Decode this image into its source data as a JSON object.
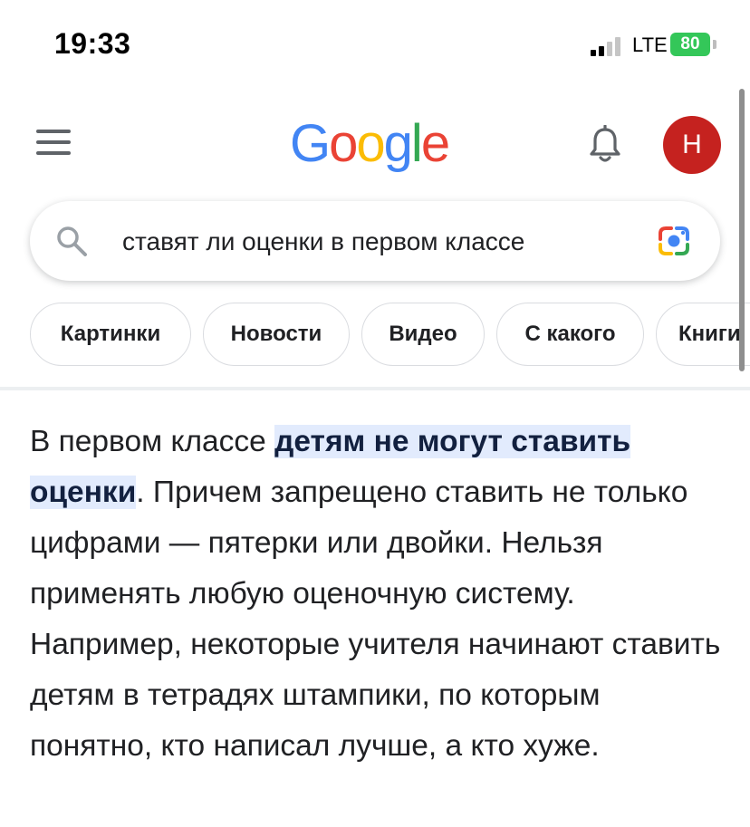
{
  "status_bar": {
    "time": "19:33",
    "network": "LTE",
    "battery": "80"
  },
  "header": {
    "logo_letters": [
      "G",
      "o",
      "o",
      "g",
      "l",
      "e"
    ],
    "avatar_letter": "H",
    "icons": {
      "menu": "hamburger-menu-icon",
      "notifications": "bell-icon"
    }
  },
  "search": {
    "query": "ставят ли оценки в первом классе",
    "icons": {
      "search": "search-icon",
      "lens": "google-lens-icon"
    }
  },
  "chips": [
    "Картинки",
    "Новости",
    "Видео",
    "С какого",
    "Книги"
  ],
  "answer": {
    "before": "В первом классе ",
    "highlight": "детям не могут ставить оценки",
    "after": ". Причем запрещено ставить не только цифрами — пятерки или двойки. Нельзя применять любую оценочную систему. Например, некоторые учителя начинают ставить детям в тетрадях штампики, по которым понятно, кто написал лучше, а кто хуже."
  },
  "colors": {
    "blue": "#4285f4",
    "red": "#ea4335",
    "yellow": "#fbbc05",
    "green": "#34a853",
    "avatar": "#c5221f",
    "highlight": "#e2ebfd",
    "battery": "#34c759"
  }
}
